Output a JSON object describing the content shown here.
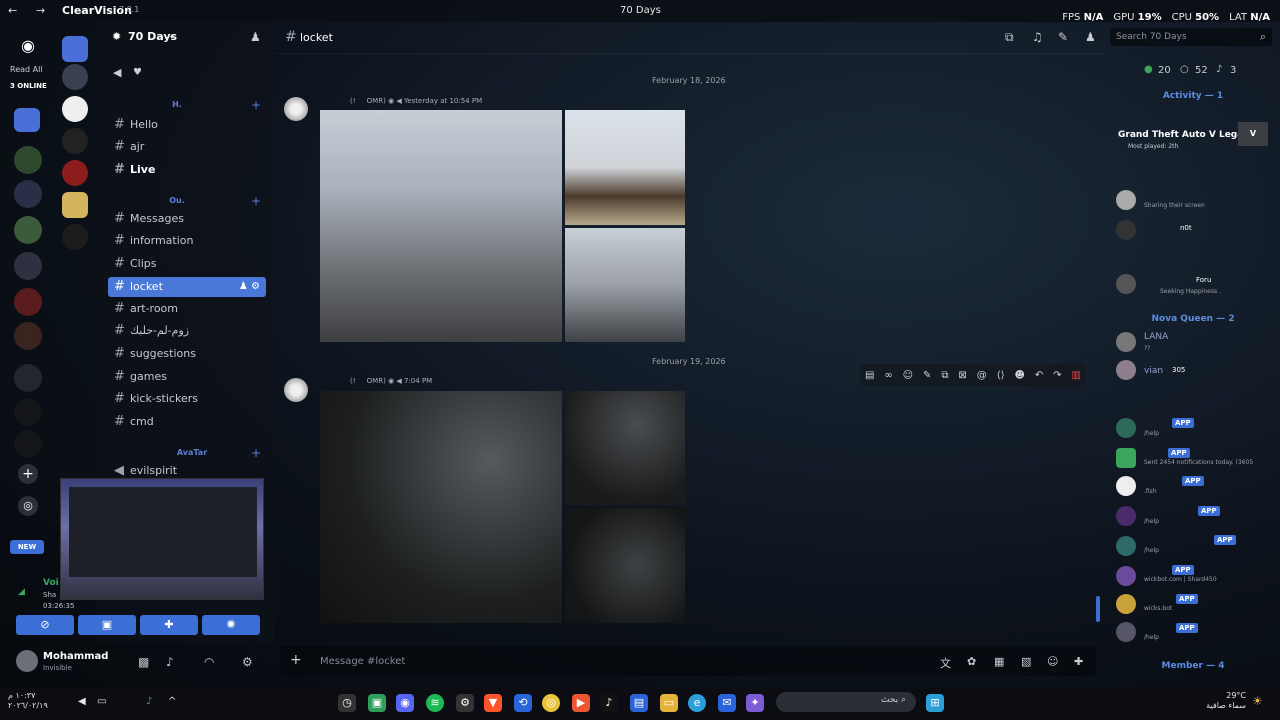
{
  "titlebar": {
    "app_name": "ClearVision",
    "version": "7.0.1",
    "window_title": "70 Days",
    "stats": [
      {
        "label": "FPS",
        "value": "N/A"
      },
      {
        "label": "GPU",
        "value": "19%"
      },
      {
        "label": "CPU",
        "value": "50%"
      },
      {
        "label": "LAT",
        "value": "N/A"
      }
    ]
  },
  "rail": {
    "read_all": "Read All",
    "online": "3 ONLINE",
    "new_badge": "NEW"
  },
  "sidebar": {
    "guild_name": "70 Days",
    "categories": {
      "h": "H.",
      "ou": "Ou.",
      "avatar": "AvaTar"
    },
    "channels": [
      "Hello",
      "ajr",
      "Live",
      "Messages",
      "information",
      "Clips",
      "locket",
      "art-room",
      "زوم-لم-حلبك",
      "suggestions",
      "games",
      "kick-stickers",
      "cmd"
    ],
    "voice_channel": "evilspirit",
    "voice_label": "Voi",
    "voice_sub": "Sha",
    "voice_timer": "03:26:35"
  },
  "user": {
    "name": "Mohammad",
    "status": "Invisible"
  },
  "header": {
    "channel": "locket",
    "search_placeholder": "Search 70 Days"
  },
  "messages": [
    {
      "date": "February 18, 2026",
      "author_tag": "OMR",
      "time": "Yesterday at 10:54 PM"
    },
    {
      "date": "February 19, 2026",
      "author_tag": "OMR",
      "time": "7:04 PM"
    }
  ],
  "composer": {
    "placeholder": "Message #locket"
  },
  "members": {
    "counts": {
      "online": "20",
      "idle": "52",
      "other": "3"
    },
    "activity_header": "Activity — 1",
    "game": "Grand Theft Auto V Legacy",
    "game_sub": "Most played: 2th",
    "sharing": "Sharing their screen",
    "status_not": "n0t",
    "foru": "Foru",
    "seeking": "Seeking Happiness .",
    "nova_header": "Nova Queen — 2",
    "lana": "LANA",
    "lana_sub": "??",
    "vian": "vian",
    "vian_badge": "305",
    "app_label": "APP",
    "bots": [
      {
        "name": "/help"
      },
      {
        "name": "Sent 2454 notifications today. (3605"
      },
      {
        "name": ".fish"
      },
      {
        "name": "/help"
      },
      {
        "name": "/help"
      },
      {
        "name": "wickbot.com | Shard450"
      },
      {
        "name": "wicks.bot"
      },
      {
        "name": "/help"
      }
    ],
    "member_header": "Member — 4"
  },
  "taskbar": {
    "search": "بحث",
    "time": "١٠:٣٧ م",
    "date": "٢٠٢٦/٠٢/١٩",
    "temp": "29°C",
    "weather": "سماء صافية"
  },
  "colors": {
    "accent": "#4a78d8",
    "delete": "#e54b4b"
  }
}
